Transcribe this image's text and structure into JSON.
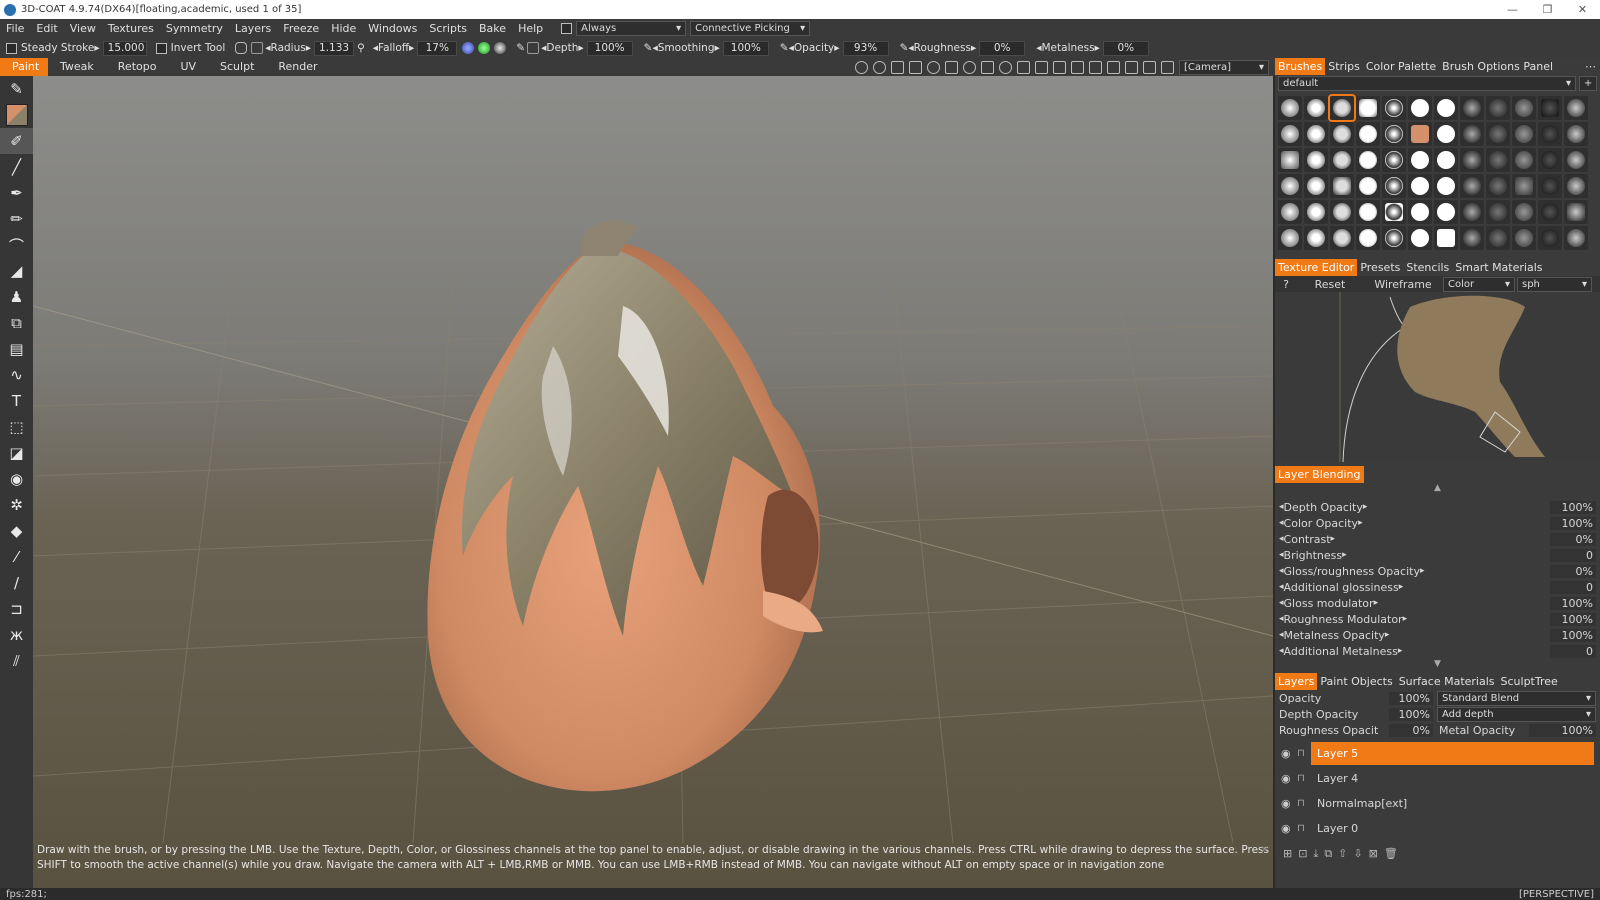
{
  "title_bar": {
    "title": "3D-COAT 4.9.74(DX64)[floating,academic, used 1 of 35]",
    "controls": [
      "—",
      "❐",
      "✕"
    ]
  },
  "menu": {
    "items": [
      "File",
      "Edit",
      "View",
      "Textures",
      "Symmetry",
      "Layers",
      "Freeze",
      "Hide",
      "Windows",
      "Scripts",
      "Bake",
      "Help"
    ],
    "always_label": "Always",
    "picking_label": "Connective Picking"
  },
  "toolbar": {
    "steady_stroke_label": "Steady Stroke",
    "steady_stroke_value": "15.000",
    "invert_tool_label": "Invert Tool",
    "radius_label": "Radius",
    "radius_value": "1.133",
    "falloff_label": "Falloff",
    "falloff_value": "17%",
    "depth_label": "Depth",
    "depth_value": "100%",
    "smoothing_label": "Smoothing",
    "smoothing_value": "100%",
    "opacity_label": "Opacity",
    "opacity_value": "93%",
    "roughness_label": "Roughness",
    "roughness_value": "0%",
    "metalness_label": "Metalness",
    "metalness_value": "0%"
  },
  "rooms": {
    "items": [
      "Paint",
      "Tweak",
      "Retopo",
      "UV",
      "Sculpt",
      "Render"
    ],
    "active": 0,
    "camera_label": "[Camera]"
  },
  "left_tools": [
    "brush-icon",
    "color-swatch-icon",
    "paint-brush-icon",
    "line-icon",
    "pen-icon",
    "fill-icon",
    "smudge-icon",
    "stamp-icon",
    "transform-icon",
    "copy-icon",
    "erase-icon",
    "curve-icon",
    "text-icon",
    "frame-icon",
    "eraser-icon",
    "eye-icon",
    "gear-icon",
    "eraser2-icon",
    "picker-icon",
    "knife-icon",
    "iron-icon",
    "butterfly-icon",
    "ruler-icon"
  ],
  "viewport": {
    "hint": "Draw with the brush, or by pressing the LMB. Use the Texture, Depth, Color, or Glossiness channels at the top panel to enable, adjust, or disable drawing in the various channels. Press CTRL while drawing to depress the surface. Press SHIFT to smooth the active channel(s) while you draw. Navigate the camera with ALT + LMB,RMB or MMB. You can use LMB+RMB instead of MMB. You can navigate without ALT on empty space or in navigation zone"
  },
  "right_panel": {
    "brush_tabs": [
      "Brushes",
      "Strips",
      "Color Palette",
      "Brush Options Panel"
    ],
    "brush_preset": "default",
    "texture_tabs": [
      "Texture Editor",
      "Presets",
      "Stencils",
      "Smart Materials"
    ],
    "texture_controls": {
      "help": "?",
      "reset": "Reset",
      "wireframe": "Wireframe",
      "channel": "Color",
      "sphere": "sph"
    },
    "layer_blending_tab": "Layer Blending",
    "blending_props": [
      {
        "label": "Depth Opacity",
        "value": "100%"
      },
      {
        "label": "Color Opacity",
        "value": "100%"
      },
      {
        "label": "Contrast",
        "value": "0%"
      },
      {
        "label": "Brightness",
        "value": "0"
      },
      {
        "label": "Gloss/roughness Opacity",
        "value": "0%"
      },
      {
        "label": "Additional glossiness",
        "value": "0"
      },
      {
        "label": "Gloss modulator",
        "value": "100%"
      },
      {
        "label": "Roughness Modulator",
        "value": "100%"
      },
      {
        "label": "Metalness Opacity",
        "value": "100%"
      },
      {
        "label": "Additional Metalness",
        "value": "0"
      }
    ],
    "layer_tabs": [
      "Layers",
      "Paint Objects",
      "Surface Materials",
      "SculptTree"
    ],
    "layer_props": {
      "opacity_label": "Opacity",
      "opacity_value": "100%",
      "blend_mode": "Standard Blend",
      "depth_opacity_label": "Depth Opacity",
      "depth_opacity_value": "100%",
      "depth_mode": "Add depth",
      "roughness_label": "Roughness Opacit",
      "roughness_value": "0%",
      "metal_label": "Metal Opacity",
      "metal_value": "100%"
    },
    "layers": [
      {
        "name": "Layer 5",
        "active": true
      },
      {
        "name": "Layer 4",
        "active": false
      },
      {
        "name": "Normalmap[ext]",
        "active": false
      },
      {
        "name": "Layer 0",
        "active": false
      }
    ]
  },
  "status": {
    "fps": "fps:281;",
    "projection": "[PERSPECTIVE]"
  },
  "colors": {
    "accent": "#f07a16",
    "mesh_skin": "#d4906a",
    "mesh_clay": "#8a8168"
  }
}
